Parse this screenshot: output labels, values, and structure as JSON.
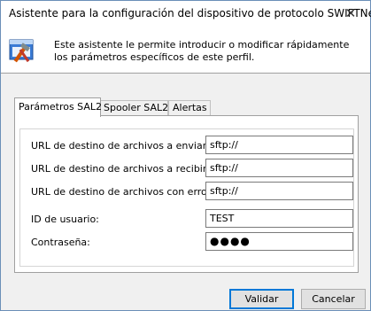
{
  "window": {
    "title": "Asistente para la configuración del dispositivo de protocolo SWIFTNet",
    "close_glyph": "✕"
  },
  "header": {
    "icon": "wizard-tools-icon",
    "description": "Este asistente le permite introducir o modificar rápidamente los parámetros específicos de este perfil."
  },
  "tabs": [
    {
      "label": "Parámetros SAL2",
      "active": true
    },
    {
      "label": "Spooler SAL2",
      "active": false
    },
    {
      "label": "Alertas",
      "active": false
    }
  ],
  "form": {
    "send_url": {
      "label": "URL de destino de archivos a enviar:",
      "value": "sftp://"
    },
    "receive_url": {
      "label": "URL de destino de archivos a recibir:",
      "value": "sftp://"
    },
    "error_url": {
      "label": "URL de destino de archivos con errores:",
      "value": "sftp://"
    },
    "user_id": {
      "label": "ID de usuario:",
      "value": "TEST"
    },
    "password": {
      "label": "Contraseña:",
      "value": "●●●●"
    }
  },
  "buttons": {
    "ok": "Validar",
    "cancel": "Cancelar"
  },
  "colors": {
    "accent": "#0078d7",
    "window_border": "#6b8fb8",
    "dialog_bg": "#f0f0f0"
  }
}
